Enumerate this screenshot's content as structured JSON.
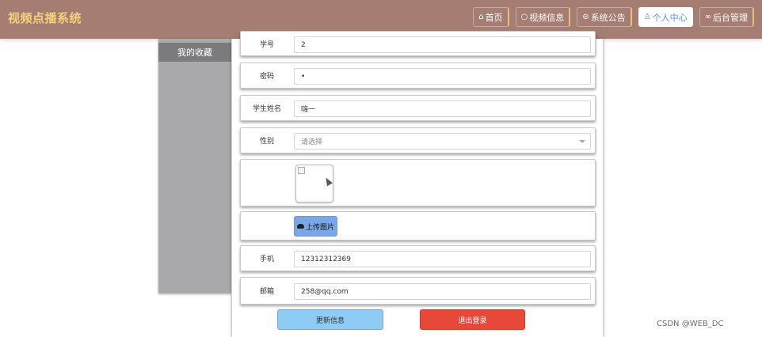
{
  "header": {
    "brand": "视频点播系统",
    "nav": [
      {
        "label": "首页",
        "icon": "home-icon",
        "glyph": "⌂",
        "active": false
      },
      {
        "label": "视频信息",
        "icon": "chat-icon",
        "glyph": "○",
        "active": false
      },
      {
        "label": "系统公告",
        "icon": "settings-icon",
        "glyph": "⊜",
        "active": false
      },
      {
        "label": "个人中心",
        "icon": "user-icon",
        "glyph": "♙",
        "active": true
      },
      {
        "label": "后台管理",
        "icon": "link-icon",
        "glyph": "∞",
        "active": false
      }
    ]
  },
  "sidebar": {
    "items": [
      {
        "label": "我的收藏"
      }
    ]
  },
  "form": {
    "student_id": {
      "label": "学号",
      "value": "2"
    },
    "password": {
      "label": "密码",
      "value": "•"
    },
    "student_name": {
      "label": "学生姓名",
      "value": "嗨一"
    },
    "gender": {
      "label": "性别",
      "placeholder": "请选择"
    },
    "upload": {
      "label": "上传图片"
    },
    "phone": {
      "label": "手机",
      "value": "12312312369"
    },
    "email": {
      "label": "邮箱",
      "value": "258@qq.com"
    }
  },
  "actions": {
    "update_label": "更新信息",
    "logout_label": "退出登录"
  },
  "watermark": "CSDN @WEB_DC",
  "colors": {
    "header_bg": "#a67d73",
    "brand": "#f5d27a",
    "sidebar_bg": "#a9a9ab",
    "update_btn": "#8ecbf5",
    "logout_btn": "#e8483a",
    "upload_btn": "#7aa7e6"
  }
}
